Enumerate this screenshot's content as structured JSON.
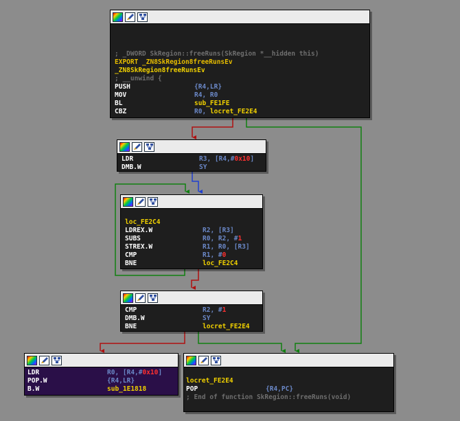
{
  "nodes": {
    "entry": {
      "comment1": "; _DWORD SkRegion::freeRuns(SkRegion *__hidden this)",
      "export_kw": "EXPORT",
      "export_sym": " _ZN8SkRegion8freeRunsEv",
      "label": "_ZN8SkRegion8freeRunsEv",
      "comment2": "; __unwind {",
      "instructions": [
        {
          "mn": "PUSH",
          "op": "{R4,LR}"
        },
        {
          "mn": "MOV",
          "op": "R4, R0"
        },
        {
          "mn": "BL",
          "op": "sub_FE1FE"
        },
        {
          "mn": "CBZ",
          "op_a": "R0, ",
          "op_b": "locret_FE2E4"
        }
      ]
    },
    "ldr_dmb": {
      "ldr_mn": "LDR",
      "ldr_a": "R3, [R4,#",
      "ldr_num": "0x10",
      "ldr_b": "]",
      "dmb_mn": "DMB.W",
      "dmb_op": "SY"
    },
    "loop": {
      "label": "loc_FE2C4",
      "i1_mn": "LDREX.W",
      "i1_op": "R2, [R3]",
      "i2_mn": "SUBS",
      "i2_a": "R0, R2, #",
      "i2_num": "1",
      "i3_mn": "STREX.W",
      "i3_op": "R1, R0, [R3]",
      "i4_mn": "CMP",
      "i4_a": "R1, #",
      "i4_num": "0",
      "i5_mn": "BNE",
      "i5_op": "loc_FE2C4"
    },
    "cmp": {
      "i1_mn": "CMP",
      "i1_a": "R2, #",
      "i1_num": "1",
      "i2_mn": "DMB.W",
      "i2_op": "SY",
      "i3_mn": "BNE",
      "i3_op": "locret_FE2E4"
    },
    "tail": {
      "i1_mn": "LDR",
      "i1_a": "R0, [R4,#",
      "i1_num": "0x10",
      "i1_b": "]",
      "i2_mn": "POP.W",
      "i2_op": "{R4,LR}",
      "i3_mn": "B.W",
      "i3_op": "sub_1E1818"
    },
    "ret": {
      "label": "locret_FE2E4",
      "i1_mn": "POP",
      "i1_op": "{R4,PC}",
      "comment": "; End of function SkRegion::freeRuns(void)"
    }
  },
  "colors": {
    "background": "#8c8c8c",
    "edge_false": "#b01010",
    "edge_true": "#108010",
    "edge_uncond": "#2040d0"
  },
  "icons": [
    "palette-color-icon",
    "edit-pencil-icon",
    "graph-view-icon"
  ]
}
